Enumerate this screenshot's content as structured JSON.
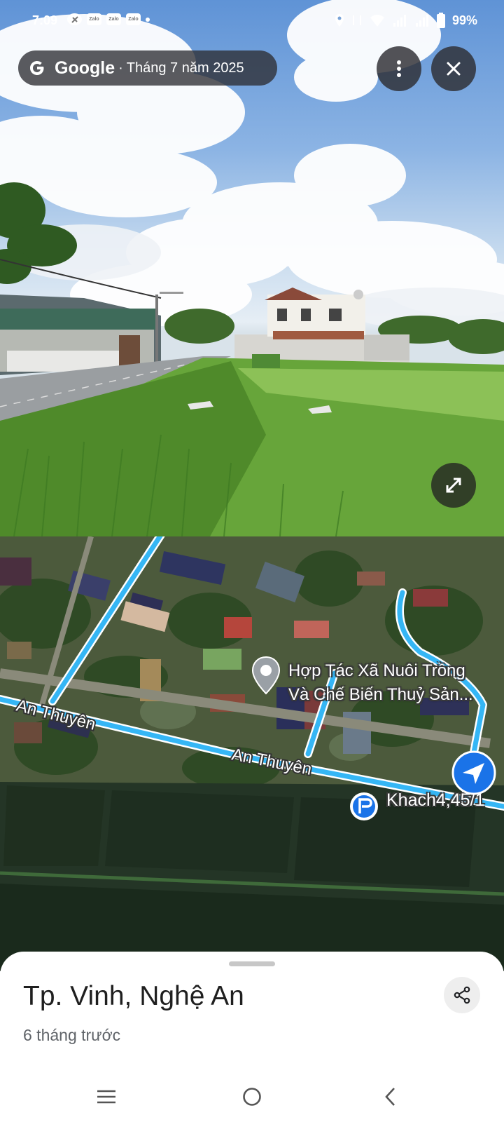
{
  "status_bar": {
    "time": "7:09",
    "notifications": [
      "Zalo",
      "Zalo",
      "Zalo"
    ],
    "battery": "99%"
  },
  "street_view": {
    "source": "Google",
    "separator": "·",
    "date": "Tháng 7 năm 2025",
    "icons": [
      "google-g-icon",
      "more-vert-icon",
      "close-icon",
      "expand-icon"
    ]
  },
  "map": {
    "road_label_1": "An Thuyên",
    "road_label_2": "An Thuyên",
    "poi": {
      "line1": "Hợp Tác Xã Nuôi Trồng",
      "line2": "Và Chế Biến Thuỷ Sản..."
    },
    "destination": "Khach4,45/1",
    "colors": {
      "route": "#35b6f5",
      "nav_arrow": "#1a73e8"
    }
  },
  "place": {
    "title": "Tp. Vinh, Nghệ An",
    "subtitle": "6 tháng trước"
  },
  "nav_bar": {
    "keys": [
      "recents",
      "home",
      "back"
    ]
  }
}
